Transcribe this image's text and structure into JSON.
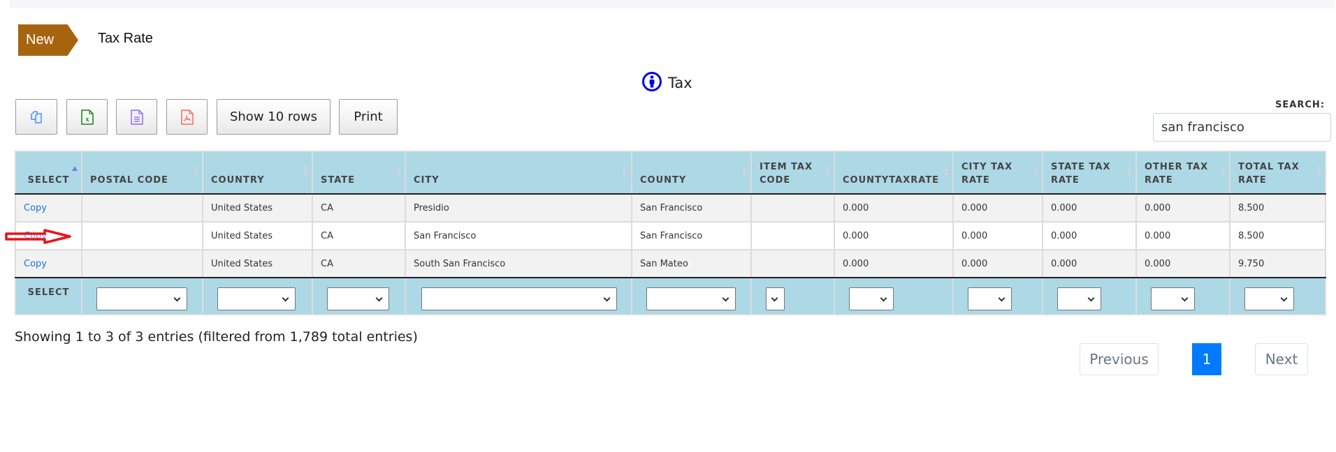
{
  "header": {
    "badge_label": "New",
    "page_title": "Tax Rate"
  },
  "section": {
    "title": "Tax",
    "icon": "person-info-icon"
  },
  "toolbar": {
    "buttons": [
      {
        "type": "icon",
        "icon": "copy-icon",
        "tooltip": ""
      },
      {
        "type": "icon",
        "icon": "excel-icon",
        "tooltip": ""
      },
      {
        "type": "icon",
        "icon": "csv-icon",
        "tooltip": ""
      },
      {
        "type": "icon",
        "icon": "pdf-icon",
        "tooltip": ""
      }
    ],
    "show_rows_label": "Show 10 rows",
    "print_label": "Print"
  },
  "search": {
    "label": "SEARCH:",
    "value": "san francisco",
    "placeholder": ""
  },
  "table": {
    "columns": [
      {
        "label": "SELECT",
        "sort": "asc"
      },
      {
        "label": "POSTAL CODE",
        "sort": "none"
      },
      {
        "label": "COUNTRY",
        "sort": "none"
      },
      {
        "label": "STATE",
        "sort": "none"
      },
      {
        "label": "CITY",
        "sort": "none"
      },
      {
        "label": "COUNTY",
        "sort": "none"
      },
      {
        "label": "ITEM TAX CODE",
        "sort": "none"
      },
      {
        "label": "COUNTYTAXRATE",
        "sort": "none"
      },
      {
        "label": "CITY TAX RATE",
        "sort": "none"
      },
      {
        "label": "STATE TAX RATE",
        "sort": "none"
      },
      {
        "label": "OTHER TAX RATE",
        "sort": "none"
      },
      {
        "label": "TOTAL TAX RATE",
        "sort": "none"
      }
    ],
    "rows": [
      {
        "select": "Copy",
        "postal_code": "",
        "country": "United States",
        "state": "CA",
        "city": "Presidio",
        "county": "San Francisco",
        "item_tax_code": "",
        "county_tax_rate": "0.000",
        "city_tax_rate": "0.000",
        "state_tax_rate": "0.000",
        "other_tax_rate": "0.000",
        "total_tax_rate": "8.500"
      },
      {
        "select": "Copy",
        "postal_code": "",
        "country": "United States",
        "state": "CA",
        "city": "San Francisco",
        "county": "San Francisco",
        "item_tax_code": "",
        "county_tax_rate": "0.000",
        "city_tax_rate": "0.000",
        "state_tax_rate": "0.000",
        "other_tax_rate": "0.000",
        "total_tax_rate": "8.500"
      },
      {
        "select": "Copy",
        "postal_code": "",
        "country": "United States",
        "state": "CA",
        "city": "South San Francisco",
        "county": "San Mateo",
        "item_tax_code": "",
        "county_tax_rate": "0.000",
        "city_tax_rate": "0.000",
        "state_tax_rate": "0.000",
        "other_tax_rate": "0.000",
        "total_tax_rate": "9.750"
      }
    ],
    "footer_label": "SELECT",
    "footer_filters": [
      "",
      "",
      "",
      "",
      "",
      "",
      "",
      "",
      "",
      "",
      ""
    ]
  },
  "annotation": {
    "arrow_color": "#e8141c",
    "points_to_row": 2
  },
  "info_text": "Showing 1 to 3 of 3 entries (filtered from 1,789 total entries)",
  "pagination": {
    "previous_label": "Previous",
    "pages": [
      "1"
    ],
    "current_page": "1",
    "next_label": "Next"
  },
  "colors": {
    "badge": "#a6640f",
    "table_header": "#add8e6",
    "link": "#1a73e8",
    "active_page": "#007bff",
    "info_icon": "#0000ee"
  }
}
